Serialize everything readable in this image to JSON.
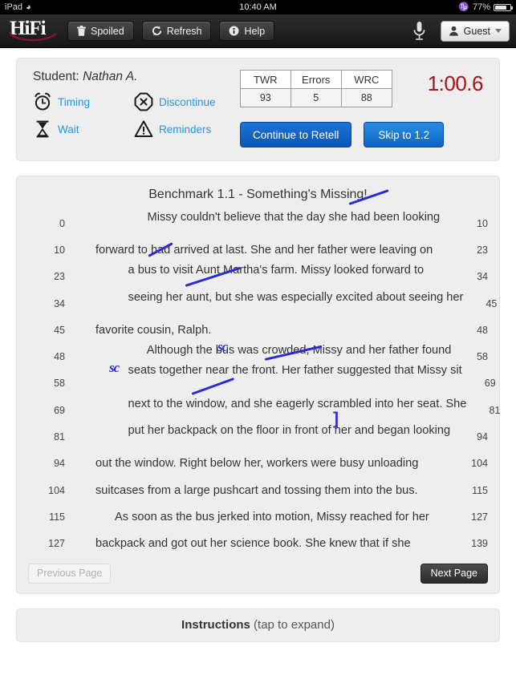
{
  "status_bar": {
    "device": "iPad",
    "wifi_icon": "wifi-icon",
    "time": "10:40 AM",
    "bluetooth_icon": "bluetooth-icon",
    "battery_percent": "77%",
    "battery_icon": "battery-icon"
  },
  "navbar": {
    "logo_text": "HiFi",
    "buttons": [
      {
        "label": "Spoiled",
        "icon": "trash-icon"
      },
      {
        "label": "Refresh",
        "icon": "refresh-icon"
      },
      {
        "label": "Help",
        "icon": "help-circle-icon"
      }
    ],
    "mic_icon": "microphone-icon",
    "user_label": "Guest",
    "user_icon": "person-icon",
    "caret_icon": "chevron-down-icon"
  },
  "session": {
    "student_label": "Student:",
    "student_name": "Nathan A.",
    "actions": [
      {
        "label": "Timing",
        "icon": "alarm-clock-icon"
      },
      {
        "label": "Discontinue",
        "icon": "octagon-x-icon"
      },
      {
        "label": "Wait",
        "icon": "hourglass-icon"
      },
      {
        "label": "Reminders",
        "icon": "warning-triangle-icon"
      }
    ],
    "score_table": {
      "headers": [
        "TWR",
        "Errors",
        "WRC"
      ],
      "values": [
        "93",
        "5",
        "88"
      ]
    },
    "timer": "1:00.6",
    "timer_color": "#a81414",
    "continue_label": "Continue to Retell",
    "skip_label": "Skip to 1.2"
  },
  "passage": {
    "title": "Benchmark 1.1 - Something's Missing!",
    "lines": [
      {
        "start": "0",
        "text": "Missy couldn't believe that the day she had been looking",
        "end": "10",
        "indent": true
      },
      {
        "start": "10",
        "text": "forward to had arrived at last. She and her father were leaving on",
        "end": "23",
        "indent": false
      },
      {
        "start": "23",
        "text": "a bus to visit Aunt Martha's farm. Missy looked forward to",
        "end": "34",
        "indent": false
      },
      {
        "start": "34",
        "text": "seeing her aunt, but she was especially excited about seeing her",
        "end": "45",
        "indent": false
      },
      {
        "start": "45",
        "text": "favorite cousin, Ralph.",
        "end": "48",
        "indent": false
      },
      {
        "start": "48",
        "text": "Although the bus was crowded, Missy and her father found",
        "end": "58",
        "indent": true
      },
      {
        "start": "58",
        "text": "seats together near the front. Her father suggested that Missy sit",
        "end": "69",
        "indent": false
      },
      {
        "start": "69",
        "text": "next to the window, and she eagerly scrambled into her seat. She",
        "end": "81",
        "indent": false
      },
      {
        "start": "81",
        "text": "put her backpack on the floor in front of her and began looking",
        "end": "94",
        "indent": false
      },
      {
        "start": "94",
        "text": "out the window. Right below her, workers were busy unloading",
        "end": "104",
        "indent": false
      },
      {
        "start": "104",
        "text": "suitcases from a large pushcart and tossing them into the bus.",
        "end": "115",
        "indent": false
      },
      {
        "start": "115",
        "text": "As soon as the bus jerked into motion, Missy reached for her",
        "end": "127",
        "indent": true
      },
      {
        "start": "127",
        "text": "backpack and got out her science book. She knew that if she",
        "end": "139",
        "indent": false
      }
    ],
    "marks": {
      "color": "#2b2bd6",
      "sc_label": "sc",
      "bracket_label": "]",
      "items": [
        {
          "type": "slash",
          "line": 0,
          "word": "looking"
        },
        {
          "type": "slash",
          "line": 2,
          "word": "Aunt"
        },
        {
          "type": "slash",
          "line": 3,
          "word": "especially"
        },
        {
          "type": "sc",
          "line": 5,
          "word": "crowded"
        },
        {
          "type": "sc",
          "line": 6,
          "word": "together"
        },
        {
          "type": "slash",
          "line": 6,
          "word": "suggested"
        },
        {
          "type": "slash",
          "line": 7,
          "word": "eagerly"
        },
        {
          "type": "bracket",
          "line": 8,
          "word": "began|looking"
        }
      ]
    },
    "previous_label": "Previous Page",
    "next_label": "Next Page"
  },
  "instructions": {
    "title": "Instructions",
    "hint": "(tap to expand)"
  }
}
